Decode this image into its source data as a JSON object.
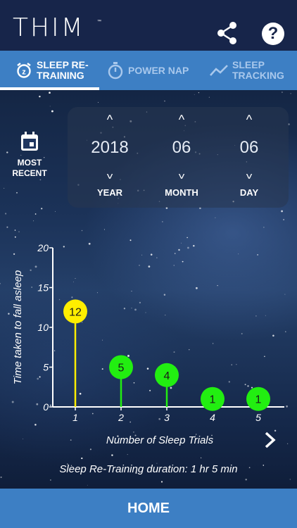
{
  "app": {
    "logo_text": "THIM",
    "logo_mark": "™"
  },
  "header": {
    "share_icon": "share-icon",
    "help_icon": "?"
  },
  "tabs": [
    {
      "label": "SLEEP RE-TRAINING",
      "icon": "alarm-clock-icon",
      "active": true
    },
    {
      "label": "POWER NAP",
      "icon": "stopwatch-icon",
      "active": false
    },
    {
      "label": "SLEEP TRACKING",
      "icon": "trend-line-icon",
      "active": false
    }
  ],
  "most_recent": {
    "label": "MOST RECENT",
    "icon": "calendar-icon"
  },
  "date_picker": {
    "year": {
      "value": "2018",
      "label": "YEAR"
    },
    "month": {
      "value": "06",
      "label": "MONTH"
    },
    "day": {
      "value": "06",
      "label": "DAY"
    },
    "chevron_up": "^",
    "chevron_down": "^"
  },
  "chart_data": {
    "type": "scatter",
    "title": "",
    "xlabel": "Number of Sleep Trials",
    "ylabel": "Time taken to fall asleep",
    "x": [
      1,
      2,
      3,
      4,
      5
    ],
    "values": [
      12,
      5,
      4,
      1,
      1
    ],
    "point_labels": [
      "12",
      "5",
      "4",
      "1",
      "1"
    ],
    "point_colors": [
      "#ffee00",
      "#22ee11",
      "#22ee11",
      "#22ee11",
      "#22ee11"
    ],
    "xticks": [
      "1",
      "2",
      "3",
      "4",
      "5"
    ],
    "yticks": [
      "0",
      "5",
      "10",
      "15",
      "20"
    ],
    "ylim": [
      0,
      20
    ],
    "grid": false
  },
  "footer": {
    "duration_text": "Sleep Re-Training duration: 1 hr 5 min",
    "next_icon": "chevron-right-icon",
    "home_label": "HOME"
  }
}
